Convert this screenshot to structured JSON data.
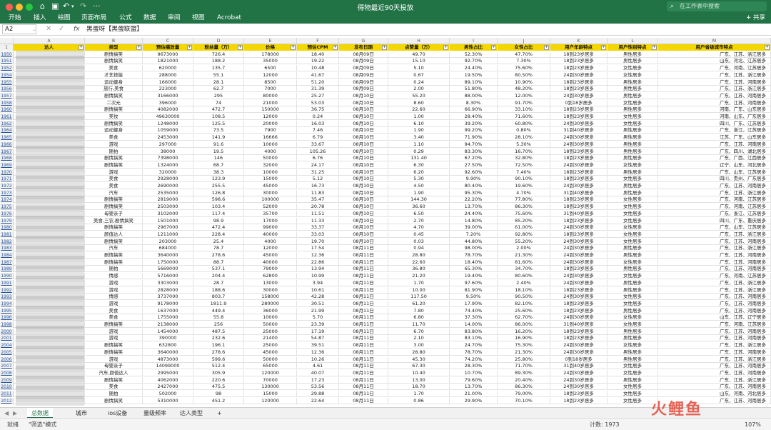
{
  "app": {
    "doc_title": "得物最近90天投放",
    "search_placeholder": "在工作表中搜索",
    "share": "共享",
    "menus": [
      "开始",
      "插入",
      "绘图",
      "页面布局",
      "公式",
      "数据",
      "审阅",
      "视图",
      "Acrobat"
    ]
  },
  "formula_bar": {
    "cell_ref": "A2",
    "fx": "fx",
    "content": "黑蛋呀【黑蛋联盟】"
  },
  "columns": [
    "A",
    "B",
    "C",
    "D",
    "E",
    "F",
    "G",
    "H",
    "I",
    "J",
    "K",
    "L",
    "M"
  ],
  "header": [
    "达人",
    "类型",
    "预估播放量",
    "粉丝量（万）",
    "价格",
    "预估CPM",
    "发布日期",
    "点赞量（万）",
    "男性占比",
    "女性占比",
    "用户年龄特点",
    "用户性别特点",
    "用户省级城市特点"
  ],
  "header_row_number": "1",
  "rows": [
    [
      "1950",
      "剧情搞笑",
      "9673000",
      "726.4",
      "178000",
      "18.40",
      "08月09日",
      "49.70",
      "52.30%",
      "47.70%",
      "18到23岁居多",
      "男性居多",
      "广东、江苏、浙江居多"
    ],
    [
      "1951",
      "剧情搞笑",
      "1821000",
      "188.2",
      "35000",
      "19.22",
      "08月09日",
      "15.10",
      "92.70%",
      "7.30%",
      "18到23岁居多",
      "男性居多",
      "山东、河北、江苏居多"
    ],
    [
      "1952",
      "美食",
      "620000",
      "135.7",
      "6500",
      "10.48",
      "08月09日",
      "5.10",
      "24.40%",
      "75.60%",
      "18到23岁居多",
      "女性居多",
      "广东、河南、江苏居多"
    ],
    [
      "1954",
      "才艺技能",
      "288000",
      "55.1",
      "12000",
      "41.67",
      "08月09日",
      "0.67",
      "19.50%",
      "80.50%",
      "24到30岁居多",
      "女性居多",
      "广东、江苏、浙江居多"
    ],
    [
      "1955",
      "运动健身",
      "166000",
      "28.1",
      "8500",
      "51.20",
      "08月09日",
      "0.24",
      "89.10%",
      "10.90%",
      "18到23岁居多",
      "男性居多",
      "广东、江苏、河南居多"
    ],
    [
      "1956",
      "旅行,美食",
      "223000",
      "62.7",
      "7000",
      "31.39",
      "08月09日",
      "2.00",
      "51.80%",
      "48.20%",
      "18到23岁居多",
      "男性居多",
      "广东、江苏、浙江居多"
    ],
    [
      "1957",
      "剧情搞笑",
      "3166000",
      "295",
      "80000",
      "25.27",
      "08月10日",
      "55.20",
      "88.00%",
      "12.00%",
      "24到30岁居多",
      "男性居多",
      "广东、江苏、河南居多"
    ],
    [
      "1958",
      "二次元",
      "396000",
      "74",
      "21000",
      "53.03",
      "08月10日",
      "8.60",
      "8.30%",
      "91.70%",
      "0到18岁居多",
      "女性居多",
      "广东、江苏、河南居多"
    ],
    [
      "1960",
      "剧情搞笑",
      "4082000",
      "472.7",
      "150000",
      "36.75",
      "08月10日",
      "22.60",
      "66.90%",
      "33.10%",
      "18到23岁居多",
      "男性居多",
      "河南、广东、山东居多"
    ],
    [
      "1961",
      "美妆",
      "49630000",
      "108.5",
      "12000",
      "0.24",
      "08月10日",
      "1.00",
      "28.40%",
      "71.60%",
      "18到23岁居多",
      "女性居多",
      "河南、山东、广东居多"
    ],
    [
      "1962",
      "剧情搞笑",
      "1248000",
      "125.5",
      "20000",
      "16.03",
      "08月10日",
      "6.10",
      "39.20%",
      "60.80%",
      "24到30岁居多",
      "女性居多",
      "四川、广东、江苏居多"
    ],
    [
      "1964",
      "运动健身",
      "1059000",
      "73.5",
      "7900",
      "7.46",
      "08月10日",
      "1.90",
      "99.20%",
      "0.80%",
      "31到40岁居多",
      "男性居多",
      "广东、浙江、江苏居多"
    ],
    [
      "1965",
      "美食",
      "2453000",
      "141.9",
      "16666",
      "6.79",
      "08月10日",
      "3.40",
      "71.90%",
      "28.10%",
      "24到30岁居多",
      "男性居多",
      "江苏、广东、山东居多"
    ],
    [
      "1966",
      "游戏",
      "297000",
      "91.6",
      "10000",
      "33.67",
      "08月10日",
      "1.10",
      "94.70%",
      "5.30%",
      "24到30岁居多",
      "男性居多",
      "广东、江苏、河南居多"
    ],
    [
      "1967",
      "随拍",
      "38000",
      "19.5",
      "4000",
      "105.26",
      "08月10日",
      "0.29",
      "83.30%",
      "16.70%",
      "18到23岁居多",
      "男性居多",
      "广东、四川、湖北居多"
    ],
    [
      "1968",
      "剧情搞笑",
      "7398000",
      "146",
      "50000",
      "6.76",
      "08月10日",
      "131.40",
      "67.20%",
      "32.80%",
      "18到23岁居多",
      "男性居多",
      "广东、广西、江西居多"
    ],
    [
      "1969",
      "剧情搞笑",
      "1324000",
      "68.7",
      "32000",
      "24.17",
      "08月10日",
      "6.30",
      "27.50%",
      "72.50%",
      "24到30岁居多",
      "女性居多",
      "辽宁、山东、河北居多"
    ],
    [
      "1970",
      "游戏",
      "320000",
      "38.3",
      "10000",
      "31.25",
      "08月10日",
      "6.20",
      "92.60%",
      "7.40%",
      "18到23岁居多",
      "男性居多",
      "广东、山东、江苏居多"
    ],
    [
      "1971",
      "美食",
      "2928000",
      "123.9",
      "15000",
      "5.12",
      "08月10日",
      "5.30",
      "9.90%",
      "90.10%",
      "18到23岁居多",
      "女性居多",
      "四川、贵州、广东居多"
    ],
    [
      "1972",
      "美食",
      "2690000",
      "255.5",
      "45000",
      "16.73",
      "08月10日",
      "4.50",
      "80.40%",
      "19.60%",
      "24到30岁居多",
      "男性居多",
      "广东、江苏、河南居多"
    ],
    [
      "1973",
      "汽车",
      "2535000",
      "126.8",
      "30000",
      "11.83",
      "08月10日",
      "1.90",
      "95.30%",
      "4.70%",
      "31到40岁居多",
      "男性居多",
      "广东、江苏、浙江居多"
    ],
    [
      "1974",
      "剧情搞笑",
      "2819000",
      "598.6",
      "100000",
      "35.47",
      "08月10日",
      "144.30",
      "22.20%",
      "77.80%",
      "18到23岁居多",
      "女性居多",
      "广东、河南、江苏居多"
    ],
    [
      "1975",
      "剧情搞笑",
      "2503000",
      "103.4",
      "52000",
      "20.78",
      "08月10日",
      "36.60",
      "13.70%",
      "86.30%",
      "18到23岁居多",
      "女性居多",
      "广东、河南、江苏居多"
    ],
    [
      "1976",
      "母婴亲子",
      "3102000",
      "117.4",
      "35700",
      "11.51",
      "08月10日",
      "6.50",
      "24.40%",
      "75.60%",
      "31到40岁居多",
      "女性居多",
      "广东、浙江、江苏居多"
    ],
    [
      "1979",
      "美食,三农,剧情搞笑",
      "1501000",
      "98.9",
      "17000",
      "11.33",
      "08月10日",
      "2.70",
      "14.80%",
      "85.20%",
      "18到23岁居多",
      "女性居多",
      "四川、广东、重庆居多"
    ],
    [
      "1980",
      "剧情搞笑",
      "2967000",
      "472.4",
      "99000",
      "33.37",
      "08月10日",
      "4.70",
      "39.00%",
      "61.00%",
      "24到30岁居多",
      "女性居多",
      "广东、山东、江苏居多"
    ],
    [
      "1981",
      "颜值达人",
      "1211000",
      "228.4",
      "40000",
      "33.03",
      "08月10日",
      "0.45",
      "7.20%",
      "92.80%",
      "18到23岁居多",
      "女性居多",
      "广东、江苏、浙江居多"
    ],
    [
      "1982",
      "剧情搞笑",
      "203000",
      "25.4",
      "4000",
      "19.70",
      "08月10日",
      "0.03",
      "44.80%",
      "55.20%",
      "24到30岁居多",
      "女性居多",
      "广东、江苏、河南居多"
    ],
    [
      "1983",
      "汽车",
      "684000",
      "78.7",
      "12000",
      "17.54",
      "08月11日",
      "0.94",
      "98.00%",
      "2.00%",
      "24到30岁居多",
      "男性居多",
      "广东、江苏、浙江居多"
    ],
    [
      "1984",
      "剧情搞笑",
      "3640000",
      "278.6",
      "45000",
      "12.36",
      "08月11日",
      "28.80",
      "78.70%",
      "21.30%",
      "24到30岁居多",
      "男性居多",
      "广东、江苏、河南居多"
    ],
    [
      "1987",
      "剧情搞笑",
      "1750000",
      "88.7",
      "40000",
      "22.86",
      "08月11日",
      "22.60",
      "18.40%",
      "81.60%",
      "24到30岁居多",
      "女性居多",
      "广东、江苏、河南居多"
    ],
    [
      "1989",
      "随拍",
      "5669000",
      "537.1",
      "79000",
      "13.94",
      "08月11日",
      "36.80",
      "65.30%",
      "34.70%",
      "18到23岁居多",
      "男性居多",
      "广东、江苏、河南居多"
    ],
    [
      "1990",
      "情感",
      "5716000",
      "204.4",
      "62800",
      "10.99",
      "08月11日",
      "21.20",
      "19.40%",
      "80.60%",
      "24到30岁居多",
      "女性居多",
      "广东、河南、江苏居多"
    ],
    [
      "1991",
      "游戏",
      "3303000",
      "28.7",
      "13000",
      "3.94",
      "08月11日",
      "1.70",
      "97.60%",
      "2.40%",
      "24到30岁居多",
      "男性居多",
      "广东、江苏、浙江居多"
    ],
    [
      "1992",
      "游戏",
      "2828000",
      "188.6",
      "30000",
      "10.61",
      "08月11日",
      "10.00",
      "81.90%",
      "18.10%",
      "18到23岁居多",
      "男性居多",
      "广东、江苏、浙江居多"
    ],
    [
      "1993",
      "情感",
      "3737000",
      "803.7",
      "158000",
      "42.28",
      "08月11日",
      "117.50",
      "9.50%",
      "90.50%",
      "24到30岁居多",
      "女性居多",
      "广东、江苏、河南居多"
    ],
    [
      "1994",
      "游戏",
      "9178000",
      "1811.9",
      "280000",
      "30.51",
      "08月11日",
      "61.20",
      "17.90%",
      "82.10%",
      "18到23岁居多",
      "女性居多",
      "广东、江苏、河南居多"
    ],
    [
      "1995",
      "美食",
      "1637000",
      "449.4",
      "36000",
      "21.99",
      "08月11日",
      "7.80",
      "74.40%",
      "25.60%",
      "18到23岁居多",
      "男性居多",
      "广东、江苏、河南居多"
    ],
    [
      "1996",
      "美食",
      "1755000",
      "55.8",
      "10000",
      "5.70",
      "08月11日",
      "6.80",
      "37.30%",
      "62.70%",
      "24到30岁居多",
      "女性居多",
      "山东、江苏、辽宁居多"
    ],
    [
      "1998",
      "剧情搞笑",
      "2138000",
      "256",
      "50000",
      "23.39",
      "08月11日",
      "11.70",
      "14.00%",
      "86.00%",
      "31到40岁居多",
      "女性居多",
      "广东、河南、江苏居多"
    ],
    [
      "2000",
      "游戏",
      "1454000",
      "487.5",
      "25000",
      "17.19",
      "08月11日",
      "6.70",
      "83.80%",
      "16.20%",
      "18到23岁居多",
      "男性居多",
      "广东、江苏、河南居多"
    ],
    [
      "2001",
      "游戏",
      "390000",
      "232.6",
      "21400",
      "54.87",
      "08月11日",
      "2.10",
      "83.10%",
      "16.90%",
      "18到23岁居多",
      "男性居多",
      "广东、江苏、河南居多"
    ],
    [
      "2004",
      "剧情搞笑",
      "632800",
      "196.1",
      "25000",
      "39.51",
      "08月11日",
      "3.00",
      "24.70%",
      "75.30%",
      "24到30岁居多",
      "女性居多",
      "广东、江苏、浙江居多"
    ],
    [
      "2005",
      "剧情搞笑",
      "3640000",
      "278.6",
      "45000",
      "12.36",
      "08月11日",
      "28.80",
      "78.70%",
      "21.30%",
      "24到30岁居多",
      "男性居多",
      "广东、江苏、河南居多"
    ],
    [
      "2006",
      "游戏",
      "4873000",
      "599.6",
      "50000",
      "10.26",
      "08月11日",
      "45.30",
      "74.20%",
      "25.80%",
      "0到18岁居多",
      "男性居多",
      "广东、江苏、浙江居多"
    ],
    [
      "2007",
      "母婴亲子",
      "14099000",
      "512.4",
      "65000",
      "4.61",
      "08月11日",
      "67.30",
      "28.30%",
      "71.70%",
      "31到40岁居多",
      "女性居多",
      "广东、江苏、河南居多"
    ],
    [
      "2008",
      "汽车,颜值达人",
      "2995000",
      "305.9",
      "120000",
      "40.07",
      "08月11日",
      "10.40",
      "10.70%",
      "89.30%",
      "24到30岁居多",
      "女性居多",
      "广东、江苏、河南居多"
    ],
    [
      "2009",
      "剧情搞笑",
      "4062000",
      "220.6",
      "70000",
      "17.23",
      "08月11日",
      "13.00",
      "79.60%",
      "20.40%",
      "24到30岁居多",
      "男性居多",
      "广东、江苏、浙江居多"
    ],
    [
      "2010",
      "美食",
      "2427000",
      "475.5",
      "130000",
      "53.56",
      "08月11日",
      "18.70",
      "13.70%",
      "86.30%",
      "24到30岁居多",
      "女性居多",
      "广东、江苏、河南居多"
    ],
    [
      "2011",
      "随拍",
      "502000",
      "98",
      "15000",
      "29.88",
      "08月11日",
      "1.70",
      "21.00%",
      "79.00%",
      "18到23岁居多",
      "女性居多",
      "山东、河南、河北居多"
    ],
    [
      "2012",
      "剧情搞笑",
      "5310000",
      "451.2",
      "120000",
      "22.64",
      "08月11日",
      "0.86",
      "29.90%",
      "70.10%",
      "18到23岁居多",
      "女性居多",
      "广东、江苏、河南居多"
    ]
  ],
  "sheet_tabs": [
    "总数据",
    "城市",
    "ios设备",
    "量级频率",
    "达人类型"
  ],
  "add_sheet": "+",
  "status": {
    "ready": "就绪",
    "mode": "\"筛选\"模式",
    "count": "计数: 1973",
    "zoom": "107%"
  },
  "watermark": "火鲤鱼",
  "colors": {
    "ribbon": "#217346",
    "header_fill": "#f5d700",
    "row_number": "#27569d"
  }
}
